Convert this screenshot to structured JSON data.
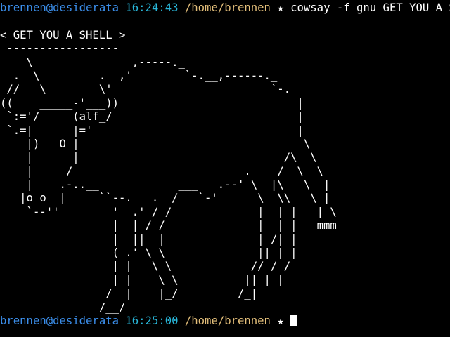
{
  "prompt_first": {
    "user_host": "brennen@desiderata",
    "time": "16:24:43",
    "path": "/home/brennen",
    "star": "★",
    "command": "cowsay -f gnu GET YOU A SHELL"
  },
  "output_lines": [
    " _________________",
    "< GET YOU A SHELL >",
    " -----------------",
    "    \\               ,-----._",
    "  .  \\         .  ,'        `-.__,------._",
    " //   \\      __\\'                        `-.",
    "((    _____-'___))                           |",
    " `:='/     (alf_/                            |",
    " `.=|      |='                               |",
    "    |)   O |                                  \\",
    "    |      |                               /\\  \\",
    "    |     /                          .    /  \\  \\",
    "    |    .-..__            ___   .--' \\  |\\   \\  |",
    "   |o o  |     ``--.___.  /   `-'      \\  \\\\   \\ |",
    "    `--''        '  .' / /             |  | |   | \\",
    "                 |  | / /              |  | |   mmm",
    "                 |  ||  |              | /| |",
    "                 ( .' \\ \\              || | |",
    "                 | |   \\ \\            // / /",
    "                 | |    \\ \\          || |_|",
    "                /  |    |_/         /_|",
    "               /__/"
  ],
  "prompt_current": {
    "user_host": "brennen@desiderata",
    "time": "16:25:00",
    "path": "/home/brennen",
    "star": "★"
  }
}
